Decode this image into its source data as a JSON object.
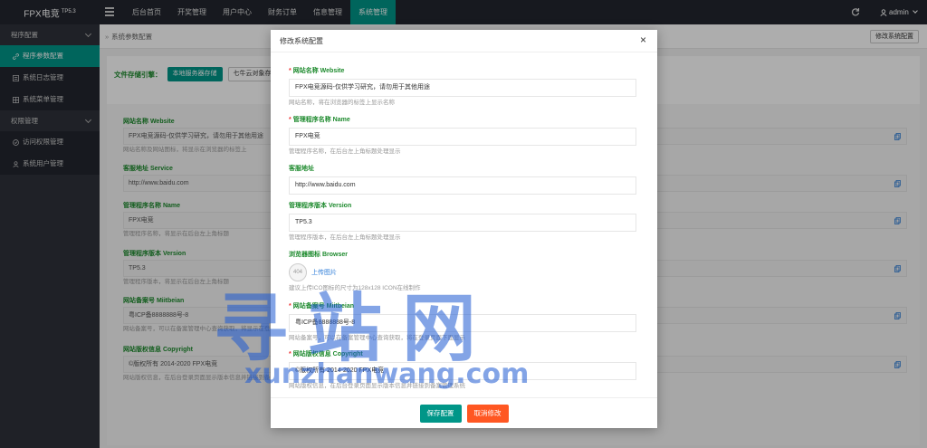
{
  "brand": {
    "name": "FPX电竞",
    "version": "TP5.3"
  },
  "topnav": [
    {
      "label": "后台首页",
      "active": false
    },
    {
      "label": "开奖管理",
      "active": false
    },
    {
      "label": "用户中心",
      "active": false
    },
    {
      "label": "财务订单",
      "active": false
    },
    {
      "label": "信息管理",
      "active": false
    },
    {
      "label": "系统管理",
      "active": true
    }
  ],
  "user": {
    "name": "admin"
  },
  "sidebar": {
    "group1": {
      "label": "程序配置"
    },
    "items1": [
      {
        "label": "程序参数配置",
        "icon": "link-icon",
        "active": true
      },
      {
        "label": "系统日志管理",
        "icon": "list-icon",
        "active": false
      },
      {
        "label": "系统菜单管理",
        "icon": "grid-icon",
        "active": false
      }
    ],
    "group2": {
      "label": "权限管理"
    },
    "items2": [
      {
        "label": "访问权限管理",
        "icon": "check-circle-icon",
        "active": false
      },
      {
        "label": "系统用户管理",
        "icon": "user-icon",
        "active": false
      }
    ]
  },
  "breadcrumb": "系统参数配置",
  "edit_button": "修改系统配置",
  "storage": {
    "label": "文件存储引擎：",
    "options": [
      "本地服务器存储",
      "七牛云对象存储"
    ]
  },
  "background_form": [
    {
      "label": "网站名称 Website",
      "value": "FPX电竞源码-仅供学习研究，请勿用于其他用途",
      "help": "网站名称及网站图标，将显示在浏览器的标签上"
    },
    {
      "label": "客服地址 Service",
      "value": "http://www.baidu.com",
      "help": ""
    },
    {
      "label": "管理程序名称 Name",
      "value": "FPX电竞",
      "help": "管理程序名称，将显示在后台左上角标题"
    },
    {
      "label": "管理程序版本 Version",
      "value": "TP5.3",
      "help": "管理程序版本，将显示在后台左上角标题"
    },
    {
      "label": "网站备案号 Miitbeian",
      "value": "粤ICP备8888888号-8",
      "help": "网站备案号，可以在备案管理中心查询获取，将显示在登录页面下面显示"
    },
    {
      "label": "网站版权信息 Copyright",
      "value": "©版权所有 2014-2020 FPX电竞",
      "help": "网站版权信息，在后台登录页面显示版本信息并链接到备案管理系统"
    }
  ],
  "modal": {
    "title": "修改系统配置",
    "fields": [
      {
        "label": "网站名称 Website",
        "required": true,
        "value": "FPX电竞源码-仅供学习研究，请勿用于其他用途",
        "help": "网站名称，将在浏览器的标签上显示名称"
      },
      {
        "label": "管理程序名称 Name",
        "required": true,
        "value": "FPX电竞",
        "help": "管理程序名称，在后台左上角标题处理显示"
      },
      {
        "label": "客服地址",
        "required": false,
        "value": "http://www.baidu.com",
        "help": ""
      },
      {
        "label": "管理程序版本 Version",
        "required": false,
        "value": "TP5.3",
        "help": "管理程序版本，在后台左上角标题处理显示"
      }
    ],
    "browser": {
      "label": "浏览器图标 Browser",
      "img_text": "404",
      "upload_label": "上传图片",
      "help": "建议上传ICO图标的尺寸为128x128 ICON在线制作"
    },
    "fields2": [
      {
        "label": "网站备案号 Miitbeian",
        "required": true,
        "value": "粤ICP备8888888号-8",
        "help": "网站备案号，可以在备案管理中心查询获取，将在登录页面下面显示"
      },
      {
        "label": "网站版权信息 Copyright",
        "required": true,
        "value": "©版权所有 2014-2020 FPX电竞",
        "help": "网站版权信息，在后台登录页面显示版本信息并链接到备案管理系统"
      }
    ],
    "save_label": "保存配置",
    "cancel_label": "取消修改"
  },
  "watermark": {
    "cn": "寻站网",
    "en": "xunzhanwang.com"
  },
  "colors": {
    "accent": "#009688",
    "topbar": "#23262e",
    "sidebar": "#2f323a",
    "label_green": "#1d8a2d",
    "cancel": "#ff5722"
  }
}
